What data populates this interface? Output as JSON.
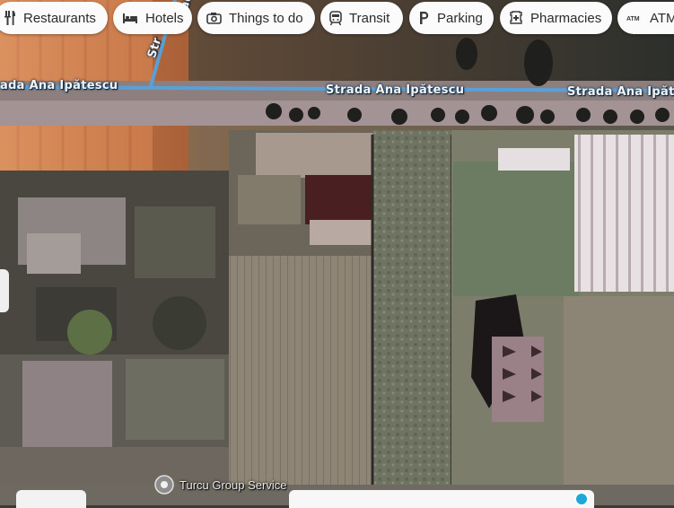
{
  "chips": [
    {
      "label": "Restaurants",
      "icon": "fork-knife-icon"
    },
    {
      "label": "Hotels",
      "icon": "bed-icon"
    },
    {
      "label": "Things to do",
      "icon": "camera-icon"
    },
    {
      "label": "Transit",
      "icon": "train-icon"
    },
    {
      "label": "Parking",
      "icon": "parking-icon"
    },
    {
      "label": "Pharmacies",
      "icon": "pharmacy-icon"
    },
    {
      "label": "ATMs",
      "icon": "atm-icon"
    }
  ],
  "map": {
    "street_name": "Strada Ana Ipătescu",
    "street_label_left": "ada Ana Ipătescu",
    "street_label_right": "Strada Ana Ipăte",
    "side_street_label": "Str",
    "side_street_label_top": "tad",
    "poi_label": "Turcu Group Service"
  },
  "colors": {
    "road": "#5aa0d8",
    "chip_bg": "#fbfbfb",
    "accent_dot": "#1ea7d8"
  }
}
